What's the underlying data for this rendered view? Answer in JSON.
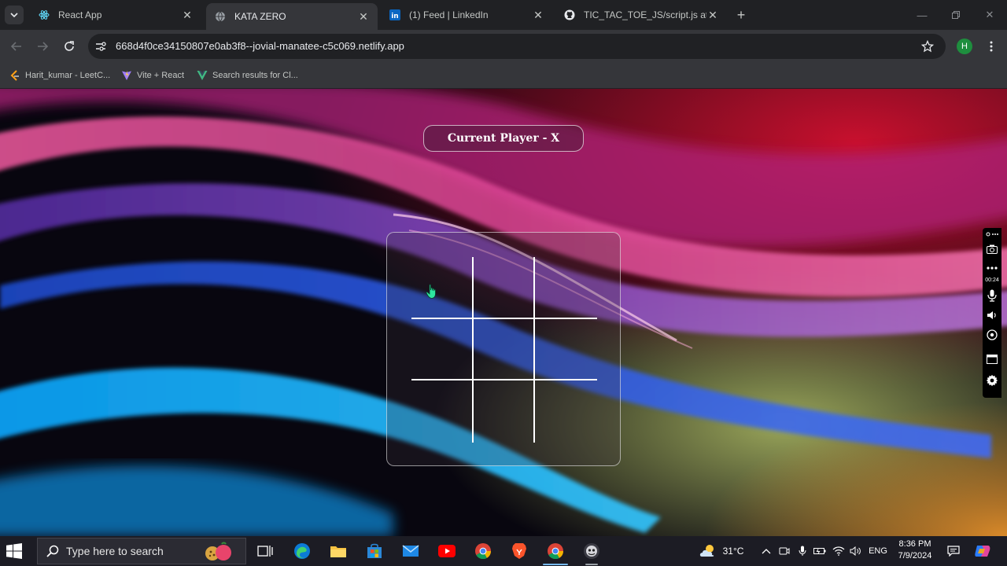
{
  "browser": {
    "tabs": [
      {
        "title": "React App",
        "icon": "react-icon"
      },
      {
        "title": "KATA ZERO",
        "icon": "globe-icon",
        "active": true
      },
      {
        "title": "(1) Feed | LinkedIn",
        "icon": "linkedin-icon"
      },
      {
        "title": "TIC_TAC_TOE_JS/script.js at ma",
        "icon": "github-icon"
      }
    ],
    "new_tab": "+",
    "address": "668d4f0ce34150807e0ab3f8--jovial-manatee-c5c069.netlify.app",
    "profile_initial": "H",
    "bookmarks": [
      {
        "label": "Harit_kumar - LeetC...",
        "icon": "leetcode-icon"
      },
      {
        "label": "Vite + React",
        "icon": "vite-icon"
      },
      {
        "label": "Search results for Cl...",
        "icon": "vue-icon"
      }
    ]
  },
  "game": {
    "status": "Current Player - X",
    "board": [
      "",
      "",
      "",
      "",
      "",
      "",
      "",
      "",
      ""
    ]
  },
  "capture_tool": {
    "timer": "00:24"
  },
  "taskbar": {
    "search_placeholder": "Type here to search",
    "weather": "31°C",
    "language": "ENG",
    "time": "8:36 PM",
    "date": "7/9/2024"
  },
  "colors": {
    "accent_blue": "#76b9ed",
    "profile_green": "#1e8e3e",
    "chrome_dark": "#202124",
    "chrome_toolbar": "#35363a"
  }
}
